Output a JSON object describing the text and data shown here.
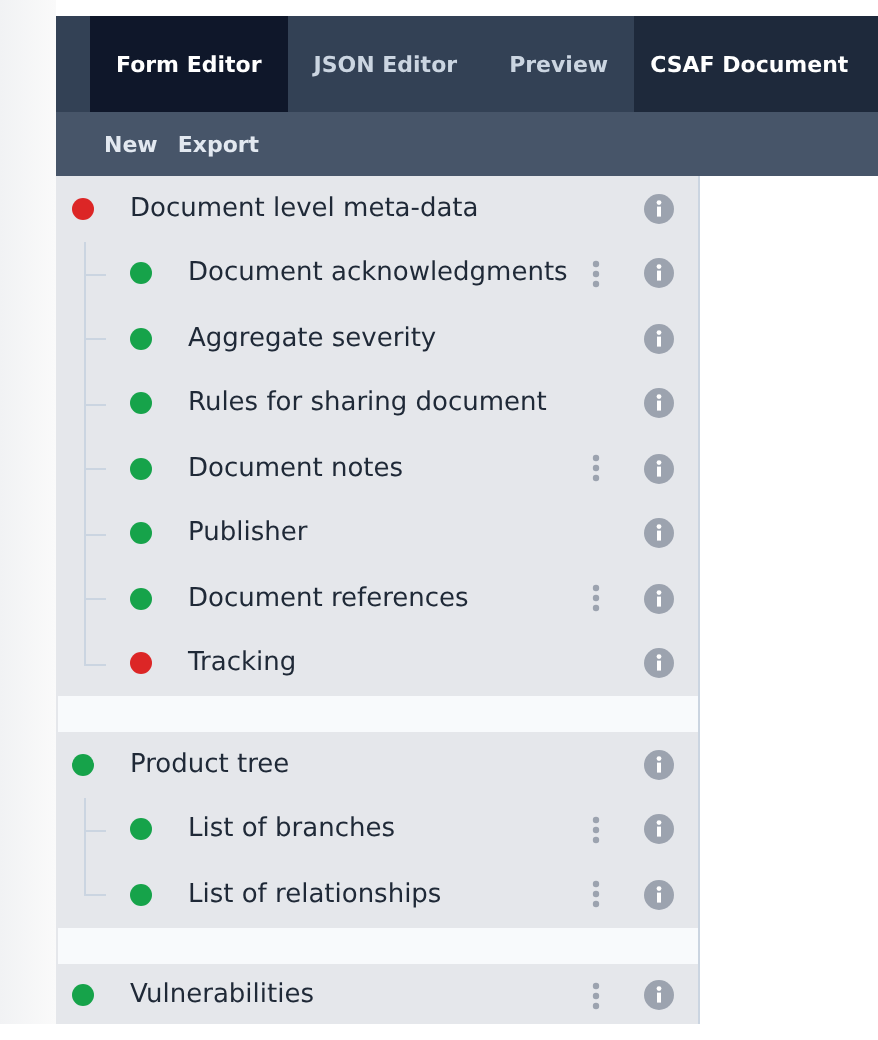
{
  "tabs": [
    {
      "label": "Form Editor",
      "selected": true
    },
    {
      "label": "JSON Editor",
      "selected": false
    },
    {
      "label": "Preview",
      "selected": false
    },
    {
      "label": "CSAF Document",
      "selected": false,
      "kind": "document"
    }
  ],
  "toolbar": [
    "New",
    "Export"
  ],
  "groups": [
    {
      "label": "Document level meta-data",
      "color": "#dc2626",
      "has_menu": false,
      "children": [
        {
          "label": "Document acknowledgments",
          "color": "#16a34a",
          "has_menu": true
        },
        {
          "label": "Aggregate severity",
          "color": "#16a34a",
          "has_menu": false
        },
        {
          "label": "Rules for sharing document",
          "color": "#16a34a",
          "has_menu": false
        },
        {
          "label": "Document notes",
          "color": "#16a34a",
          "has_menu": true
        },
        {
          "label": "Publisher",
          "color": "#16a34a",
          "has_menu": false
        },
        {
          "label": "Document references",
          "color": "#16a34a",
          "has_menu": true
        },
        {
          "label": "Tracking",
          "color": "#dc2626",
          "has_menu": false
        }
      ]
    },
    {
      "label": "Product tree",
      "color": "#16a34a",
      "has_menu": false,
      "children": [
        {
          "label": "List of branches",
          "color": "#16a34a",
          "has_menu": true
        },
        {
          "label": "List of relationships",
          "color": "#16a34a",
          "has_menu": true
        }
      ]
    },
    {
      "label": "Vulnerabilities",
      "color": "#16a34a",
      "has_menu": true
    }
  ]
}
